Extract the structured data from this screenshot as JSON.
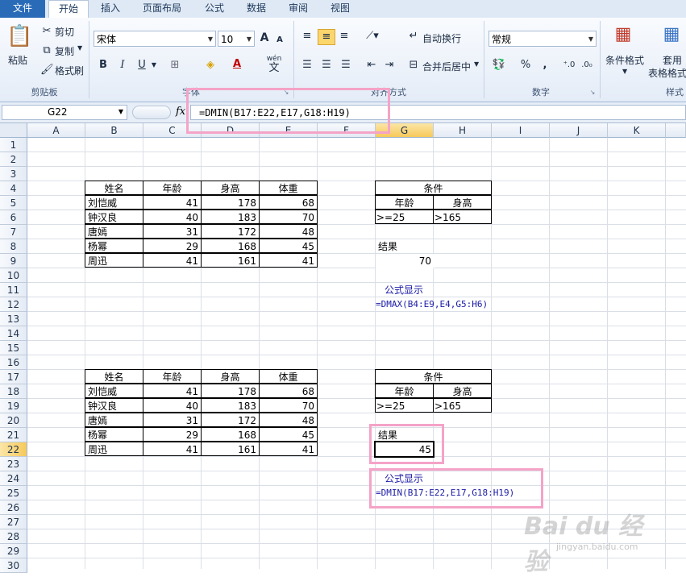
{
  "tabs": [
    "文件",
    "开始",
    "插入",
    "页面布局",
    "公式",
    "数据",
    "审阅",
    "视图"
  ],
  "ribbon": {
    "clipboard": {
      "paste": "粘贴",
      "cut": "剪切",
      "copy": "复制",
      "format_painter": "格式刷",
      "label": "剪贴板"
    },
    "font": {
      "name": "宋体",
      "size": "10",
      "bold": "B",
      "italic": "I",
      "underline": "U",
      "wen": "wén",
      "wen2": "文",
      "label": "字体",
      "grow": "A",
      "shrink": "A"
    },
    "align": {
      "wrap": "自动换行",
      "merge": "合并后居中",
      "label": "对齐方式"
    },
    "number": {
      "format": "常规",
      "percent": "%",
      "comma": ",",
      "label": "数字"
    },
    "styles": {
      "cond": "条件格式",
      "table": "套用",
      "table2": "表格格式",
      "label": "样式"
    }
  },
  "formula_bar": {
    "name_box": "G22",
    "fx": "fx",
    "formula": "=DMIN(B17:E22,E17,G18:H19)"
  },
  "columns": [
    "A",
    "B",
    "C",
    "D",
    "E",
    "F",
    "G",
    "H",
    "I",
    "J",
    "K"
  ],
  "rows": [
    "1",
    "2",
    "3",
    "4",
    "5",
    "6",
    "7",
    "8",
    "9",
    "10",
    "11",
    "12",
    "13",
    "14",
    "15",
    "16",
    "17",
    "18",
    "19",
    "20",
    "21",
    "22",
    "23",
    "24",
    "25",
    "26",
    "27",
    "28",
    "29",
    "30"
  ],
  "table1": {
    "headers": [
      "姓名",
      "年龄",
      "身高",
      "体重"
    ],
    "rows": [
      [
        "刘恺威",
        "41",
        "178",
        "68"
      ],
      [
        "钟汉良",
        "40",
        "183",
        "70"
      ],
      [
        "唐嫣",
        "31",
        "172",
        "48"
      ],
      [
        "杨幂",
        "29",
        "168",
        "45"
      ],
      [
        "周迅",
        "41",
        "161",
        "41"
      ]
    ]
  },
  "criteria1": {
    "title": "条件",
    "h1": "年龄",
    "h2": "身高",
    "v1": ">=25",
    "v2": ">165"
  },
  "result1": {
    "label": "结果",
    "value": "70",
    "formula_label": "公式显示",
    "formula": "=DMAX(B4:E9,E4,G5:H6)"
  },
  "table2": {
    "headers": [
      "姓名",
      "年龄",
      "身高",
      "体重"
    ],
    "rows": [
      [
        "刘恺威",
        "41",
        "178",
        "68"
      ],
      [
        "钟汉良",
        "40",
        "183",
        "70"
      ],
      [
        "唐嫣",
        "31",
        "172",
        "48"
      ],
      [
        "杨幂",
        "29",
        "168",
        "45"
      ],
      [
        "周迅",
        "41",
        "161",
        "41"
      ]
    ]
  },
  "criteria2": {
    "title": "条件",
    "h1": "年龄",
    "h2": "身高",
    "v1": ">=25",
    "v2": ">165"
  },
  "result2": {
    "label": "结果",
    "value": "45",
    "formula_label": "公式显示",
    "formula": "=DMIN(B17:E22,E17,G18:H19)"
  },
  "watermark": {
    "text": "Bai du 经验",
    "url": "jingyan.baidu.com"
  }
}
